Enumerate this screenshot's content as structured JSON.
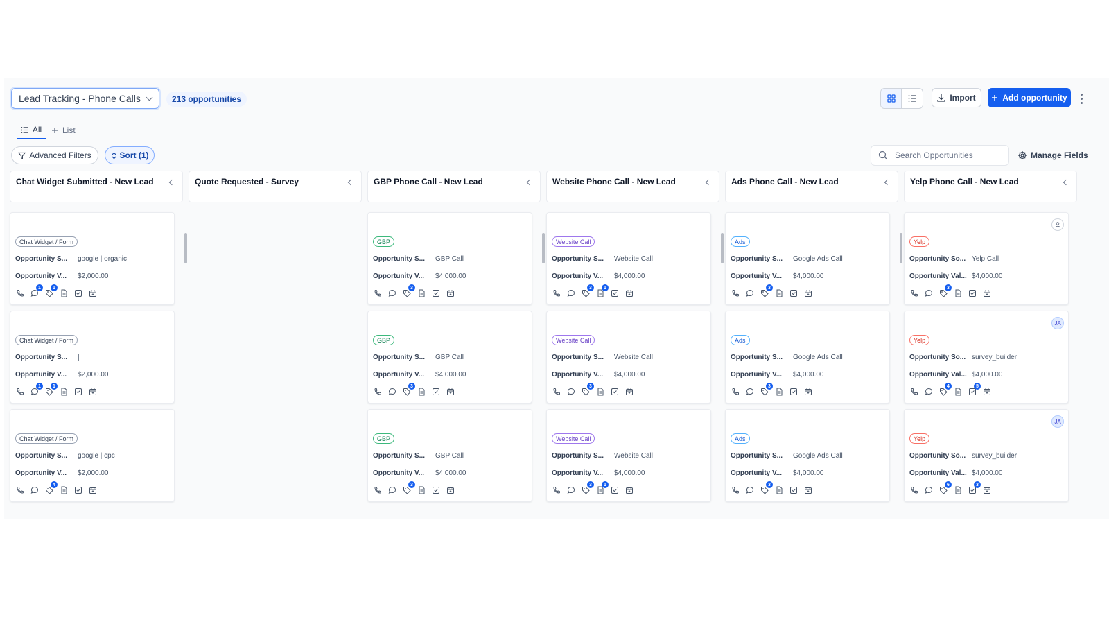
{
  "toolbar": {
    "pipeline": "Lead Tracking - Phone Calls",
    "opportunities_count": "213 opportunities",
    "import_label": "Import",
    "add_label": "Add opportunity"
  },
  "tabs": [
    {
      "label": "All"
    },
    {
      "label": "List"
    }
  ],
  "filters": {
    "advanced_label": "Advanced Filters",
    "sort_label": "Sort (1)",
    "search_placeholder": "Search Opportunities",
    "manage_label": "Manage Fields"
  },
  "columns": [
    {
      "title": "Chat Widget Submitted - New Lead",
      "cards": [
        {
          "tag": "Chat Widget / Form",
          "source_label": "Opportunity S...",
          "source": "google | organic",
          "value_label": "Opportunity V...",
          "value": "$2,000.00",
          "badges": [
            "1",
            "1"
          ]
        },
        {
          "tag": "Chat Widget / Form",
          "source_label": "Opportunity S...",
          "source": "|",
          "value_label": "Opportunity V...",
          "value": "$2,000.00",
          "badges": [
            "1",
            "1"
          ]
        },
        {
          "tag": "Chat Widget / Form",
          "source_label": "Opportunity S...",
          "source": "google | cpc",
          "value_label": "Opportunity V...",
          "value": "$2,000.00",
          "badges": [
            "",
            "4"
          ]
        }
      ]
    },
    {
      "title": "Quote Requested - Survey",
      "cards": []
    },
    {
      "title": "GBP Phone Call - New Lead",
      "cards": [
        {
          "tag": "GBP",
          "source_label": "Opportunity S...",
          "source": "GBP Call",
          "value_label": "Opportunity V...",
          "value": "$4,000.00",
          "badges": [
            "",
            "3"
          ]
        },
        {
          "tag": "GBP",
          "source_label": "Opportunity S...",
          "source": "GBP Call",
          "value_label": "Opportunity V...",
          "value": "$4,000.00",
          "badges": [
            "",
            "3"
          ]
        },
        {
          "tag": "GBP",
          "source_label": "Opportunity S...",
          "source": "GBP Call",
          "value_label": "Opportunity V...",
          "value": "$4,000.00",
          "badges": [
            "",
            "3"
          ]
        }
      ]
    },
    {
      "title": "Website Phone Call - New Lead",
      "cards": [
        {
          "tag": "Website Call",
          "source_label": "Opportunity S...",
          "source": "Website Call",
          "value_label": "Opportunity V...",
          "value": "$4,000.00",
          "badges": [
            "",
            "3",
            "1"
          ]
        },
        {
          "tag": "Website Call",
          "source_label": "Opportunity S...",
          "source": "Website Call",
          "value_label": "Opportunity V...",
          "value": "$4,000.00",
          "badges": [
            "",
            "3"
          ]
        },
        {
          "tag": "Website Call",
          "source_label": "Opportunity S...",
          "source": "Website Call",
          "value_label": "Opportunity V...",
          "value": "$4,000.00",
          "badges": [
            "",
            "3",
            "1"
          ]
        }
      ]
    },
    {
      "title": "Ads Phone Call - New Lead",
      "cards": [
        {
          "tag": "Ads",
          "source_label": "Opportunity S...",
          "source": "Google Ads Call",
          "value_label": "Opportunity V...",
          "value": "$4,000.00",
          "badges": [
            "",
            "3"
          ]
        },
        {
          "tag": "Ads",
          "source_label": "Opportunity S...",
          "source": "Google Ads Call",
          "value_label": "Opportunity V...",
          "value": "$4,000.00",
          "badges": [
            "",
            "3"
          ]
        },
        {
          "tag": "Ads",
          "source_label": "Opportunity S...",
          "source": "Google Ads Call",
          "value_label": "Opportunity V...",
          "value": "$4,000.00",
          "badges": [
            "",
            "3"
          ]
        }
      ]
    },
    {
      "title": "Yelp Phone Call - New Lead",
      "cards": [
        {
          "tag": "Yelp",
          "source_label": "Opportunity So...",
          "source": "Yelp Call",
          "value_label": "Opportunity Val...",
          "value": "$4,000.00",
          "badges": [
            "",
            "3"
          ],
          "avatar": ""
        },
        {
          "tag": "Yelp",
          "source_label": "Opportunity So...",
          "source": "survey_builder",
          "value_label": "Opportunity Val...",
          "value": "$4,000.00",
          "badges": [
            "",
            "4",
            "",
            "5"
          ],
          "avatar": "JA"
        },
        {
          "tag": "Yelp",
          "source_label": "Opportunity So...",
          "source": "survey_builder",
          "value_label": "Opportunity Val...",
          "value": "$4,000.00",
          "badges": [
            "",
            "6",
            "",
            "3"
          ],
          "avatar": "JA"
        }
      ]
    }
  ],
  "colors": {
    "primary": "#155eef",
    "border": "#eaecf0",
    "tag_gbp": "#027a48",
    "tag_web": "#6941c6",
    "tag_ads": "#175cd3",
    "tag_yelp": "#d92d20"
  }
}
